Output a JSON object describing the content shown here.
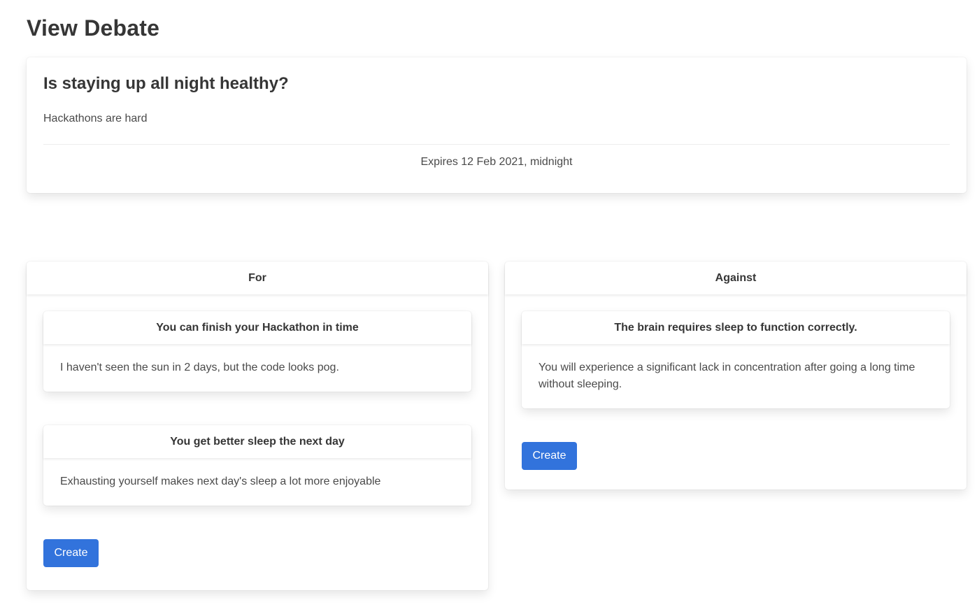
{
  "page": {
    "title": "View Debate"
  },
  "debate": {
    "title": "Is staying up all night healthy?",
    "description": "Hackathons are hard",
    "expiry": "Expires 12 Feb 2021, midnight"
  },
  "for_side": {
    "heading": "For",
    "arguments": [
      {
        "title": "You can finish your Hackathon in time",
        "body": "I haven't seen the sun in 2 days, but the code looks pog."
      },
      {
        "title": "You get better sleep the next day",
        "body": "Exhausting yourself makes next day's sleep a lot more enjoyable"
      }
    ],
    "create_label": "Create"
  },
  "against_side": {
    "heading": "Against",
    "arguments": [
      {
        "title": "The brain requires sleep to function correctly.",
        "body": "You will experience a significant lack in concentration after going a long time without sleeping."
      }
    ],
    "create_label": "Create"
  },
  "colors": {
    "primary_button": "#3273dc",
    "text": "#363636"
  }
}
